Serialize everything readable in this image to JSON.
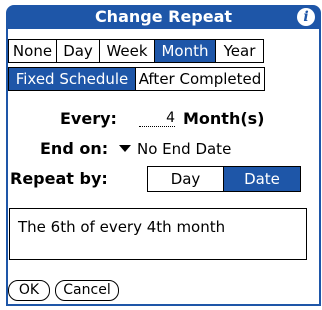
{
  "title": "Change Repeat",
  "info_icon": "info-icon",
  "period_tabs": [
    "None",
    "Day",
    "Week",
    "Month",
    "Year"
  ],
  "period_selected": "Month",
  "schedule_tabs": [
    "Fixed Schedule",
    "After Completed"
  ],
  "schedule_selected": "Fixed Schedule",
  "every": {
    "label": "Every:",
    "value": "4",
    "unit": "Month(s)"
  },
  "end_on": {
    "label": "End on:",
    "value": "No End Date"
  },
  "repeat_by": {
    "label": "Repeat by:",
    "options": [
      "Day",
      "Date"
    ],
    "selected": "Date"
  },
  "description": "The 6th of every 4th month",
  "buttons": {
    "ok": "OK",
    "cancel": "Cancel"
  },
  "colors": {
    "accent": "#1e56a8"
  }
}
